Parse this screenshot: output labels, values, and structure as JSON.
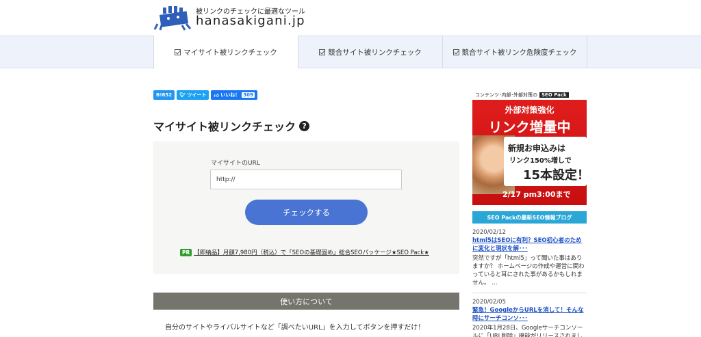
{
  "header": {
    "tagline": "被リンクのチェックに最適なツール",
    "site_name": "hanasakigani.jp"
  },
  "nav": {
    "tabs": [
      {
        "label": "マイサイト被リンクチェック",
        "active": true
      },
      {
        "label": "競合サイト被リンクチェック",
        "active": false
      },
      {
        "label": "競合サイト被リンク危険度チェック",
        "active": false
      }
    ]
  },
  "social": {
    "hatena": "B!652",
    "tweet": "ツイート",
    "like": "いいね！",
    "like_count": "309"
  },
  "main": {
    "title": "マイサイト被リンクチェック",
    "help_icon": "question-circle-icon",
    "form": {
      "url_label": "マイサイトのURL",
      "url_value": "http://",
      "button_label": "チェックする"
    },
    "pr": {
      "badge": "PR",
      "link_text": "【即納品】月額7,980円（税込）で「SEOの基礎固め」総合SEOパッケージ★SEO Pack★"
    },
    "usage": {
      "heading": "使い方について",
      "text": "自分のサイトやライバルサイトなど「調べたいURL」を入力してボタンを押すだけ！"
    }
  },
  "sidebar": {
    "ad": {
      "top_text": "コンテンツ･内部･外部対策の",
      "top_badge": "SEO Pack",
      "line1": "外部対策強化",
      "line2": "リンク増量中",
      "white1": "新規お申込みは",
      "white2": "リンク150%増しで",
      "white3": "15本設定！",
      "bottom": "2/17 pm3:00まで"
    },
    "blog_title": "SEO Packの最新SEO情報ブログ",
    "posts": [
      {
        "date": "2020/02/12",
        "title": "html5はSEOに有利？SEO初心者のために変化と現状を解･･･",
        "excerpt": "突然ですが「html5」って聞いた事はありますか？ ホームページの作成や運営に関わっていると耳にされた事があるかもしれません。 …"
      },
      {
        "date": "2020/02/05",
        "title": "緊急！GoogleからURLを消して！そんな時にサーチコンソ･･･",
        "excerpt": "2020年1月28日、Googleサーチコンソールに「URL削除」機能がリリースされまし"
      }
    ]
  },
  "colors": {
    "nav_bg": "#eef2fa",
    "button_blue": "#4a74d4",
    "section_bar": "#75756e",
    "blog_bar": "#2aa7d6",
    "ad_red": "#e21e1e"
  }
}
